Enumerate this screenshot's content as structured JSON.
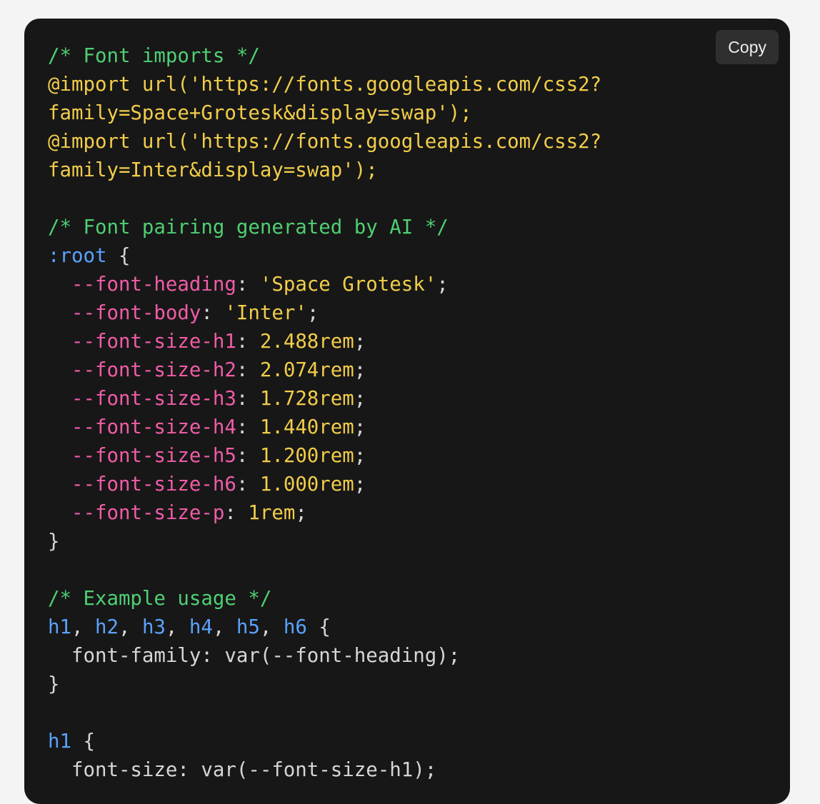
{
  "toolbar": {
    "copy_label": "Copy"
  },
  "code_lines": [
    [
      {
        "t": "/* Font imports */",
        "k": "comment"
      }
    ],
    [
      {
        "t": "@import url('https://fonts.googleapis.com/css2?",
        "k": "string"
      }
    ],
    [
      {
        "t": "family=Space+Grotesk&display=swap');",
        "k": "string"
      }
    ],
    [
      {
        "t": "@import url('https://fonts.googleapis.com/css2?",
        "k": "string"
      }
    ],
    [
      {
        "t": "family=Inter&display=swap');",
        "k": "string"
      }
    ],
    [],
    [
      {
        "t": "/* Font pairing generated by AI */",
        "k": "comment"
      }
    ],
    [
      {
        "t": ":root",
        "k": "selector"
      },
      {
        "t": " {",
        "k": "punct"
      }
    ],
    [
      {
        "t": "  ",
        "k": "plain"
      },
      {
        "t": "--font-heading",
        "k": "property"
      },
      {
        "t": ": ",
        "k": "punct"
      },
      {
        "t": "'Space Grotesk'",
        "k": "string"
      },
      {
        "t": ";",
        "k": "punct"
      }
    ],
    [
      {
        "t": "  ",
        "k": "plain"
      },
      {
        "t": "--font-body",
        "k": "property"
      },
      {
        "t": ": ",
        "k": "punct"
      },
      {
        "t": "'Inter'",
        "k": "string"
      },
      {
        "t": ";",
        "k": "punct"
      }
    ],
    [
      {
        "t": "  ",
        "k": "plain"
      },
      {
        "t": "--font-size-h1",
        "k": "property"
      },
      {
        "t": ": ",
        "k": "punct"
      },
      {
        "t": "2.488rem",
        "k": "number"
      },
      {
        "t": ";",
        "k": "punct"
      }
    ],
    [
      {
        "t": "  ",
        "k": "plain"
      },
      {
        "t": "--font-size-h2",
        "k": "property"
      },
      {
        "t": ": ",
        "k": "punct"
      },
      {
        "t": "2.074rem",
        "k": "number"
      },
      {
        "t": ";",
        "k": "punct"
      }
    ],
    [
      {
        "t": "  ",
        "k": "plain"
      },
      {
        "t": "--font-size-h3",
        "k": "property"
      },
      {
        "t": ": ",
        "k": "punct"
      },
      {
        "t": "1.728rem",
        "k": "number"
      },
      {
        "t": ";",
        "k": "punct"
      }
    ],
    [
      {
        "t": "  ",
        "k": "plain"
      },
      {
        "t": "--font-size-h4",
        "k": "property"
      },
      {
        "t": ": ",
        "k": "punct"
      },
      {
        "t": "1.440rem",
        "k": "number"
      },
      {
        "t": ";",
        "k": "punct"
      }
    ],
    [
      {
        "t": "  ",
        "k": "plain"
      },
      {
        "t": "--font-size-h5",
        "k": "property"
      },
      {
        "t": ": ",
        "k": "punct"
      },
      {
        "t": "1.200rem",
        "k": "number"
      },
      {
        "t": ";",
        "k": "punct"
      }
    ],
    [
      {
        "t": "  ",
        "k": "plain"
      },
      {
        "t": "--font-size-h6",
        "k": "property"
      },
      {
        "t": ": ",
        "k": "punct"
      },
      {
        "t": "1.000rem",
        "k": "number"
      },
      {
        "t": ";",
        "k": "punct"
      }
    ],
    [
      {
        "t": "  ",
        "k": "plain"
      },
      {
        "t": "--font-size-p",
        "k": "property"
      },
      {
        "t": ": ",
        "k": "punct"
      },
      {
        "t": "1rem",
        "k": "number"
      },
      {
        "t": ";",
        "k": "punct"
      }
    ],
    [
      {
        "t": "}",
        "k": "punct"
      }
    ],
    [],
    [
      {
        "t": "/* Example usage */",
        "k": "comment"
      }
    ],
    [
      {
        "t": "h1",
        "k": "selector"
      },
      {
        "t": ", ",
        "k": "punct"
      },
      {
        "t": "h2",
        "k": "selector"
      },
      {
        "t": ", ",
        "k": "punct"
      },
      {
        "t": "h3",
        "k": "selector"
      },
      {
        "t": ", ",
        "k": "punct"
      },
      {
        "t": "h4",
        "k": "selector"
      },
      {
        "t": ", ",
        "k": "punct"
      },
      {
        "t": "h5",
        "k": "selector"
      },
      {
        "t": ", ",
        "k": "punct"
      },
      {
        "t": "h6",
        "k": "selector"
      },
      {
        "t": " {",
        "k": "punct"
      }
    ],
    [
      {
        "t": "  font-family: var(--font-heading);",
        "k": "plain"
      }
    ],
    [
      {
        "t": "}",
        "k": "punct"
      }
    ],
    [],
    [
      {
        "t": "h1",
        "k": "selector"
      },
      {
        "t": " {",
        "k": "punct"
      }
    ],
    [
      {
        "t": "  font-size: var(--font-size-h1);",
        "k": "plain"
      }
    ]
  ]
}
